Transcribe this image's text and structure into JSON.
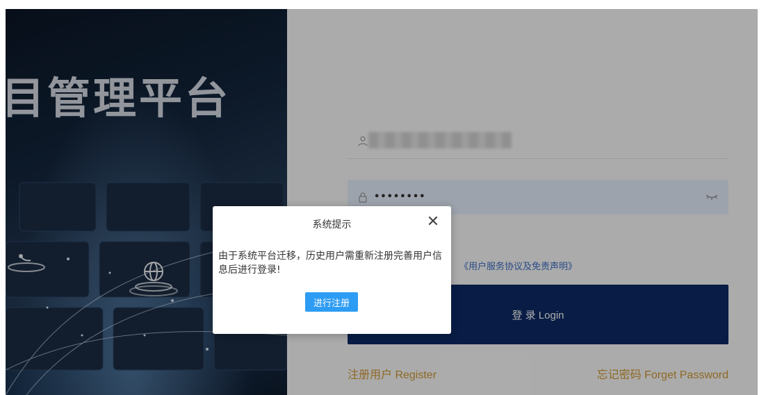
{
  "hero": {
    "title": "目管理平台"
  },
  "login": {
    "username": {
      "value": "",
      "icon": "user-icon"
    },
    "password": {
      "value": "••••••••",
      "icon": "lock-icon",
      "toggle_icon": "eye-closed-icon"
    },
    "agreement_link": "《用户服务协议及免责声明》",
    "login_button": "登 录 Login",
    "register_link": "注册用户 Register",
    "forget_link": "忘记密码 Forget Password"
  },
  "modal": {
    "title": "系统提示",
    "close_icon": "close-icon",
    "message": "由于系统平台迁移，历史用户需重新注册完善用户信息后进行登录!",
    "action_button": "进行注册"
  },
  "colors": {
    "login_button": "#0c2a66",
    "link": "#d29a35",
    "modal_button": "#2d9cf4",
    "agreement": "#3b6cc6"
  }
}
